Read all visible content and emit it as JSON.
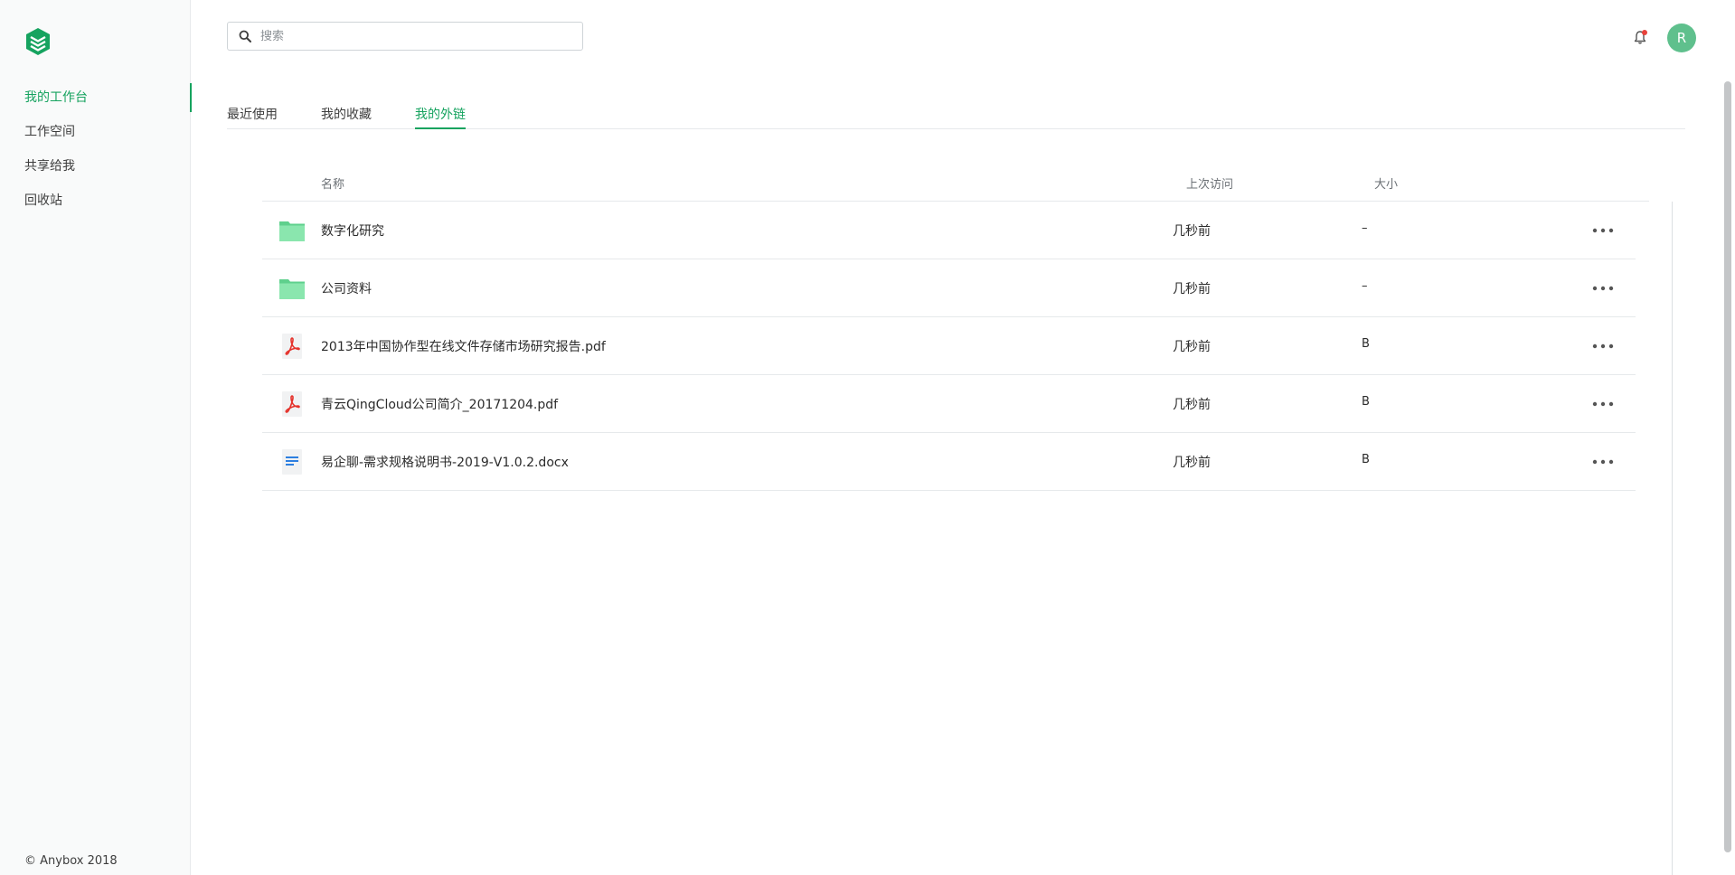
{
  "app": {
    "copyright": "© Anybox 2018",
    "brand_color": "#16a35f"
  },
  "sidebar": {
    "items": [
      {
        "label": "我的工作台",
        "active": true
      },
      {
        "label": "工作空间",
        "active": false
      },
      {
        "label": "共享给我",
        "active": false
      },
      {
        "label": "回收站",
        "active": false
      }
    ]
  },
  "header": {
    "search": {
      "placeholder": "搜索",
      "value": ""
    },
    "notification_icon": "bell-icon",
    "avatar_letter": "R",
    "avatar_color": "#5fc08d"
  },
  "tabs": [
    {
      "label": "最近使用",
      "active": false
    },
    {
      "label": "我的收藏",
      "active": false
    },
    {
      "label": "我的外链",
      "active": true
    }
  ],
  "table": {
    "columns": {
      "name": "名称",
      "last_visit": "上次访问",
      "size": "大小"
    },
    "rows": [
      {
        "type": "folder",
        "name": "数字化研究",
        "last_visit": "几秒前",
        "size": "–"
      },
      {
        "type": "folder",
        "name": "公司资料",
        "last_visit": "几秒前",
        "size": "–"
      },
      {
        "type": "pdf",
        "name": "2013年中国协作型在线文件存储市场研究报告.pdf",
        "last_visit": "几秒前",
        "size": "B"
      },
      {
        "type": "pdf",
        "name": "青云QingCloud公司简介_20171204.pdf",
        "last_visit": "几秒前",
        "size": "B"
      },
      {
        "type": "docx",
        "name": "易企聊-需求规格说明书-2019-V1.0.2.docx",
        "last_visit": "几秒前",
        "size": "B"
      }
    ]
  }
}
